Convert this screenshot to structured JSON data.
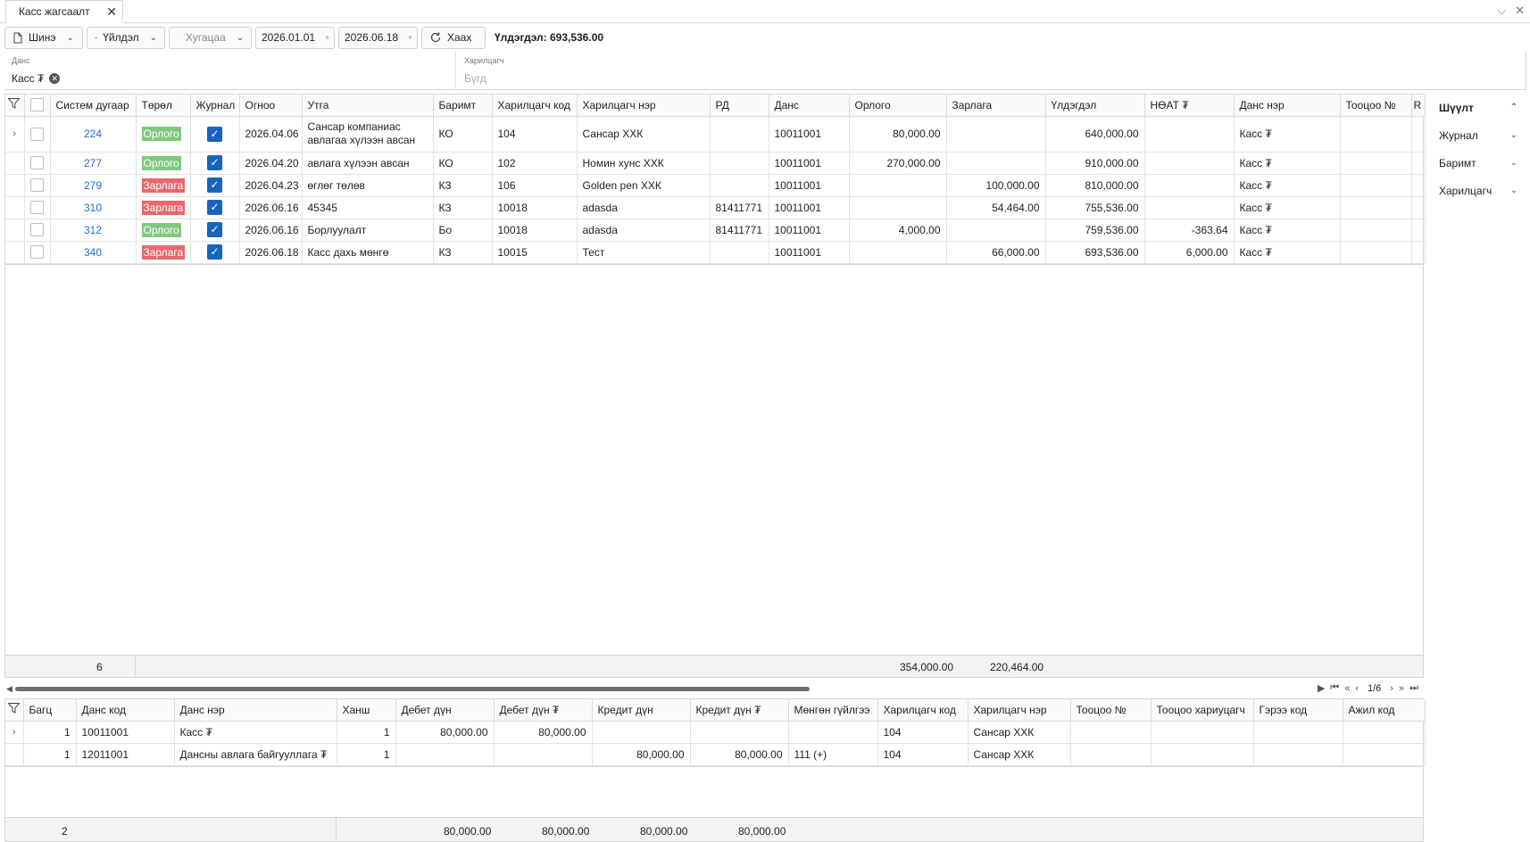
{
  "tab": {
    "title": "Касс жагсаалт",
    "close": "✕"
  },
  "window": {
    "chevron": "⌵",
    "close": "✕"
  },
  "toolbar": {
    "new_label": "Шинэ",
    "action_label": "Үйлдэл",
    "period_placeholder": "Хугацаа",
    "date_from": "2026.01.01",
    "date_to": "2026.06.18",
    "close_label": "Хаах",
    "balance_text": "Үлдэгдэл: 693,536.00"
  },
  "filters": {
    "account_label": "Данс",
    "account_value": "Касс ₮",
    "partner_label": "Харилцагч",
    "partner_placeholder": "Бүгд"
  },
  "main_grid": {
    "columns": [
      "Систем дугаар",
      "Төрөл",
      "Журнал",
      "Огноо",
      "Утга",
      "Баримт",
      "Харилцагч код",
      "Харилцагч нэр",
      "РД",
      "Данс",
      "Орлого",
      "Зарлага",
      "Үлдэгдэл",
      "НӨАТ ₮",
      "Данс нэр",
      "Тооцоо №",
      "R"
    ],
    "rows": [
      {
        "id": "224",
        "type": "Орлого",
        "type_kind": "in",
        "date": "2026.04.06",
        "desc": "Сансар компаниас авлагаа хүлээн авсан",
        "doc": "КО",
        "pcode": "104",
        "pname": "Сансар ХХК",
        "rd": "",
        "acc": "10011001",
        "income": "80,000.00",
        "expense": "",
        "balance": "640,000.00",
        "vat": "",
        "accname": "Касс ₮",
        "ref": ""
      },
      {
        "id": "277",
        "type": "Орлого",
        "type_kind": "in",
        "date": "2026.04.20",
        "desc": "авлага хүлээн авсан",
        "doc": "КО",
        "pcode": "102",
        "pname": "Номин хунс ХХК",
        "rd": "",
        "acc": "10011001",
        "income": "270,000.00",
        "expense": "",
        "balance": "910,000.00",
        "vat": "",
        "accname": "Касс ₮",
        "ref": ""
      },
      {
        "id": "279",
        "type": "Зарлага",
        "type_kind": "out",
        "date": "2026.04.23",
        "desc": "өглөг төлөв",
        "doc": "КЗ",
        "pcode": "106",
        "pname": "Golden pen ХХК",
        "rd": "",
        "acc": "10011001",
        "income": "",
        "expense": "100,000.00",
        "balance": "810,000.00",
        "vat": "",
        "accname": "Касс ₮",
        "ref": ""
      },
      {
        "id": "310",
        "type": "Зарлага",
        "type_kind": "out",
        "date": "2026.06.16",
        "desc": "45345",
        "doc": "КЗ",
        "pcode": "10018",
        "pname": "adasda",
        "rd": "81411771",
        "acc": "10011001",
        "income": "",
        "expense": "54,464.00",
        "balance": "755,536.00",
        "vat": "",
        "accname": "Касс ₮",
        "ref": ""
      },
      {
        "id": "312",
        "type": "Орлого",
        "type_kind": "in",
        "date": "2026.06.16",
        "desc": "Борлуулалт",
        "doc": "Бо",
        "pcode": "10018",
        "pname": "adasda",
        "rd": "81411771",
        "acc": "10011001",
        "income": "4,000.00",
        "expense": "",
        "balance": "759,536.00",
        "vat": "-363.64",
        "accname": "Касс ₮",
        "ref": ""
      },
      {
        "id": "340",
        "type": "Зарлага",
        "type_kind": "out",
        "date": "2026.06.18",
        "desc": "Касс дахь мөнгө",
        "doc": "КЗ",
        "pcode": "10015",
        "pname": "Тест",
        "rd": "",
        "acc": "10011001",
        "income": "",
        "expense": "66,000.00",
        "balance": "693,536.00",
        "vat": "6,000.00",
        "accname": "Касс ₮",
        "ref": ""
      }
    ],
    "summary": {
      "count": "6",
      "income_total": "354,000.00",
      "expense_total": "220,464.00"
    }
  },
  "pager": {
    "page": "1/6"
  },
  "detail_grid": {
    "columns": [
      "Багц",
      "Данс код",
      "Данс нэр",
      "Ханш",
      "Дебет дүн",
      "Дебет дүн ₮",
      "Кредит дүн",
      "Кредит дүн ₮",
      "Мөнгөн гүйлгээ",
      "Харилцагч код",
      "Харилцагч нэр",
      "Тооцоо №",
      "Тооцоо хариуцагч",
      "Гэрээ код",
      "Ажил код"
    ],
    "rows": [
      {
        "batch": "1",
        "acode": "10011001",
        "aname": "Касс ₮",
        "rate": "1",
        "debit": "80,000.00",
        "debit_mnt": "80,000.00",
        "credit": "",
        "credit_mnt": "",
        "cash": "",
        "pcode": "104",
        "pname": "Сансар ХХК"
      },
      {
        "batch": "1",
        "acode": "12011001",
        "aname": "Дансны авлага байгууллага ₮",
        "rate": "1",
        "debit": "",
        "debit_mnt": "",
        "credit": "80,000.00",
        "credit_mnt": "80,000.00",
        "cash": "111 (+)",
        "pcode": "104",
        "pname": "Сансар ХХК"
      }
    ],
    "summary": {
      "count": "2",
      "debit": "80,000.00",
      "debit_mnt": "80,000.00",
      "credit": "80,000.00",
      "credit_mnt": "80,000.00"
    }
  },
  "right_panel": {
    "items": [
      {
        "label": "Шүүлт",
        "arrow": "︿"
      },
      {
        "label": "Журнал",
        "arrow": "﹀"
      },
      {
        "label": "Баримт",
        "arrow": "﹀"
      },
      {
        "label": "Харилцагч",
        "arrow": "﹀"
      }
    ]
  },
  "colors": {
    "income_badge": "#7fc97f",
    "expense_badge": "#e8676b",
    "link": "#1a6fd1",
    "checkbox": "#1565c0"
  }
}
